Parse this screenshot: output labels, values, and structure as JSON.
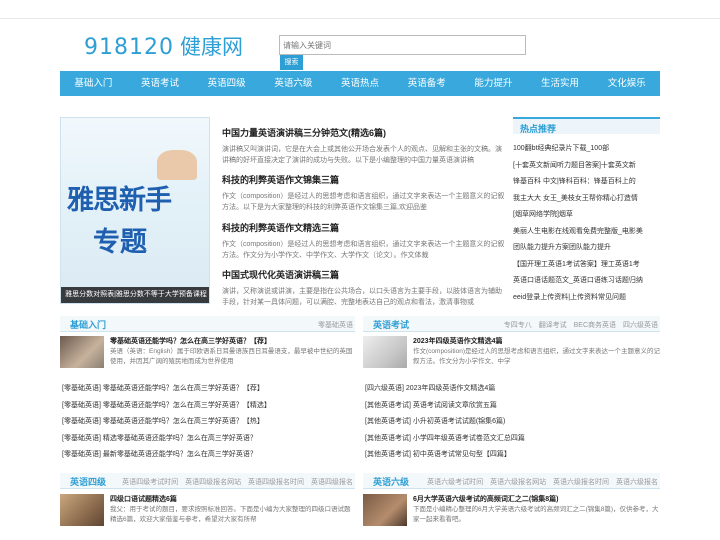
{
  "logo": {
    "number": "918120",
    "text": "健康网"
  },
  "search": {
    "placeholder": "请输入关键词",
    "button": "搜索"
  },
  "nav": [
    "基础入门",
    "英语考试",
    "英语四级",
    "英语六级",
    "英语热点",
    "英语备考",
    "能力提升",
    "生活实用",
    "文化娱乐"
  ],
  "banner": {
    "line1": "雅思新手",
    "line2": "专题",
    "caption": "雅思分数对照表|雅思分数不等于大学预备课程"
  },
  "articles": [
    {
      "title": "中国力量英语演讲稿三分钟范文(精选6篇)",
      "summary": "演讲稿又叫演讲词，它是在大会上或其他公开场合发表个人的观点、见解和主张的文稿。演讲稿的好坏直接决定了演讲的成功与失败。以下是小编整理的中国力量英语演讲稿"
    },
    {
      "title": "科技的利弊英语作文锦集三篇",
      "summary": "作文（composition）是经过人的思想考虑和语言组织，通过文字来表达一个主题意义的记叙方法。以下是为大家整理的科技的利弊英语作文锦集三篇,欢迎品鉴"
    },
    {
      "title": "科技的利弊英语作文精选三篇",
      "summary": "作文（composition）是经过人的思想考虑和语言组织，通过文字来表达一个主题意义的记叙方法。作文分为小学作文、中学作文、大学作文（论文）。作文体裁"
    },
    {
      "title": "中国式现代化英语演讲稿三篇",
      "summary": "演讲，又称演说或讲演，主要是指在公共场合，以口头语言为主要手段，以肢体语言为辅助手段，针对某一具体问题，可以满腔、完整地表达自己的观点和看法，激清事物或"
    }
  ],
  "hot": {
    "title": "热点推荐",
    "items": [
      "100翻bt经典纪录片下载_100部",
      "[十套英文新闻听力题目答案]十套英文新",
      "锋基百科 中文|锋科百科：锋基百科上的",
      "我主大大 女王_美枝女王帮你精心打造情",
      "[烟草网络学院]烟草",
      "美丽人生电影在线观看免费完整版_电影美",
      "团队能力提升方案团队能力提升",
      "【国开理工英语1考试答案】理工英语1考",
      "英语口语话题范文_英语口语练习话题归纳",
      "eeid登录上传资料|上传资料常见问题"
    ]
  },
  "sections": {
    "basic": {
      "title": "基础入门",
      "links": [
        "零基础英语"
      ],
      "feature": {
        "title": "零基础英语还能学吗？怎么在高三学好英语？【荐】",
        "summary": "英语（英语：English）属于印欧语系日耳曼语族西日耳曼语支，最早被中世纪的英国使用，并因其广阔的殖民地而成为世界使用"
      },
      "items": [
        "[零基础英语] 零基础英语还能学吗？怎么在高三学好英语？【荐】",
        "[零基础英语] 零基础英语还能学吗？怎么在高三学好英语？【精选】",
        "[零基础英语] 零基础英语还能学吗？怎么在高三学好英语？【热】",
        "[零基础英语] 精选零基础英语还能学吗？怎么在高三学好英语？",
        "[零基础英语] 最新零基础英语还能学吗？怎么在高三学好英语？"
      ]
    },
    "exam": {
      "title": "英语考试",
      "links": [
        "专四专八",
        "翻译考试",
        "BEC商务英语",
        "四六级英语"
      ],
      "feature": {
        "title": "2023年四级英语作文精选4篇",
        "summary": "作文(composition)是经过人的思想考虑和语言组织，通过文字来表达一个主题意义的记叙方法。作文分为小学作文、中学"
      },
      "items": [
        "[四六级英语] 2023年四级英语作文精选4篇",
        "[其他英语考试] 英语考试阅读文章欣赏五篇",
        "[其他英语考试] 小升初英语考试试题(锦集6篇)",
        "[其他英语考试] 小学四年级英语考试卷范文汇总四篇",
        "[其他英语考试] 初中英语考试常见句型【四篇】"
      ]
    },
    "cet4": {
      "title": "英语四级",
      "links": [
        "英语四级考试时间",
        "英语四级报名网站",
        "英语四级报名时间",
        "英语四级报名"
      ],
      "feature": {
        "title": "四级口语试题精选6篇",
        "summary": "我父：用于考试的题目，要求按照标准回答。下面是小编为大家整理的四级口语试题精选6篇，欢迎大家借鉴与参考，希望对大家有所帮"
      }
    },
    "cet6": {
      "title": "英语六级",
      "links": [
        "英语六级考试时间",
        "英语六级报名网站",
        "英语六级报名时间",
        "英语六级报名"
      ],
      "feature": {
        "title": "6月大学英语六级考试的高频词汇之二(锦集8篇)",
        "summary": "下面是小编精心整理的6月大学英语六级考试的高频词汇之二(锦集8篇)，仅供参考，大家一起来看看吧。"
      }
    }
  }
}
